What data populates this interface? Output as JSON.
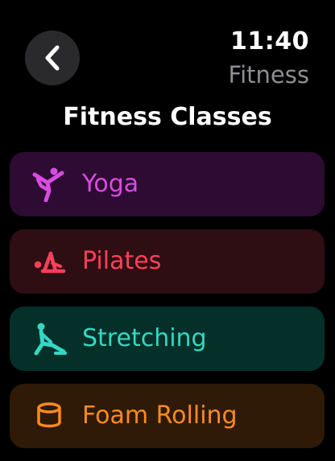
{
  "status": {
    "time": "11:40",
    "app_name": "Fitness"
  },
  "header": {
    "title": "Fitness Classes"
  },
  "classes": [
    {
      "label": "Yoga",
      "icon": "yoga-icon",
      "color": "#d84ce0",
      "bg": "#2e0b33"
    },
    {
      "label": "Pilates",
      "icon": "pilates-icon",
      "color": "#ff3f5a",
      "bg": "#2e0e13"
    },
    {
      "label": "Stretching",
      "icon": "stretching-icon",
      "color": "#34d8c2",
      "bg": "#053029"
    },
    {
      "label": "Foam Rolling",
      "icon": "foam-rolling-icon",
      "color": "#ff8a1f",
      "bg": "#2f1a07"
    }
  ]
}
